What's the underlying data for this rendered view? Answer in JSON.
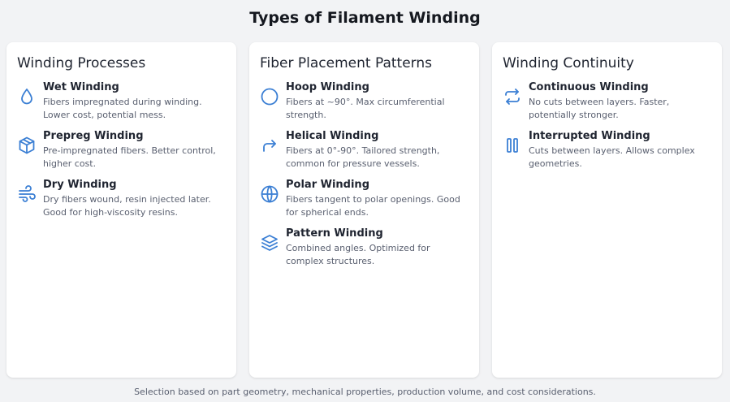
{
  "title": "Types of Filament Winding",
  "accent_color": "#3b7fd4",
  "columns": [
    {
      "title": "Winding Processes",
      "items": [
        {
          "icon": "droplet-icon",
          "title": "Wet Winding",
          "description": "Fibers impregnated during winding. Lower cost, potential mess."
        },
        {
          "icon": "box-icon",
          "title": "Prepreg Winding",
          "description": "Pre-impregnated fibers. Better control, higher cost."
        },
        {
          "icon": "wind-icon",
          "title": "Dry Winding",
          "description": "Dry fibers wound, resin injected later. Good for high-viscosity resins."
        }
      ]
    },
    {
      "title": "Fiber Placement Patterns",
      "items": [
        {
          "icon": "circle-icon",
          "title": "Hoop Winding",
          "description": "Fibers at ~90°. Max circumferential strength."
        },
        {
          "icon": "arrow-turn-icon",
          "title": "Helical Winding",
          "description": "Fibers at 0°-90°. Tailored strength, common for pressure vessels."
        },
        {
          "icon": "globe-icon",
          "title": "Polar Winding",
          "description": "Fibers tangent to polar openings. Good for spherical ends."
        },
        {
          "icon": "layers-icon",
          "title": "Pattern Winding",
          "description": "Combined angles. Optimized for complex structures."
        }
      ]
    },
    {
      "title": "Winding Continuity",
      "items": [
        {
          "icon": "repeat-icon",
          "title": "Continuous Winding",
          "description": "No cuts between layers. Faster, potentially stronger."
        },
        {
          "icon": "pause-icon",
          "title": "Interrupted Winding",
          "description": "Cuts between layers. Allows complex geometries."
        }
      ]
    }
  ],
  "footer": "Selection based on part geometry, mechanical properties, production volume, and cost considerations."
}
